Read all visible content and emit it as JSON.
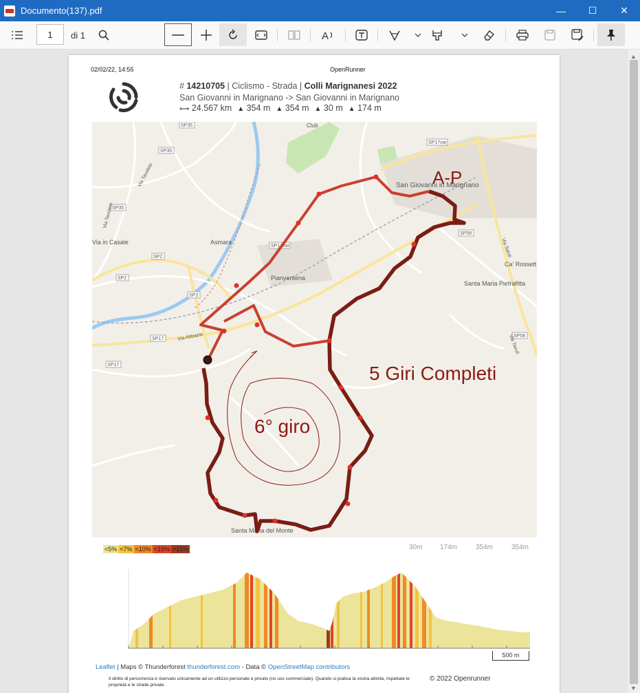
{
  "window": {
    "title": "Documento(137).pdf",
    "minimize": "—",
    "maximize": "☐",
    "close": "✕"
  },
  "toolbar": {
    "page_number": "1",
    "page_total": "di 1",
    "icons": [
      "contents-icon",
      "search-icon",
      "zoom-out-icon",
      "zoom-in-icon",
      "rotate-icon",
      "fit-width-icon",
      "two-page-icon",
      "read-aloud-icon",
      "text-icon",
      "draw-icon",
      "chevron-down-icon",
      "highlight-icon",
      "chevron-down-icon",
      "eraser-icon",
      "print-icon",
      "save-icon",
      "save-as-icon",
      "pin-icon"
    ]
  },
  "page": {
    "header_date": "02/02/22, 14:55",
    "header_site": "OpenRunner",
    "route": {
      "id_prefix": "#",
      "id": "14210705",
      "category": "| Ciclismo - Strada |",
      "name": "Colli Marignanesi 2022",
      "start_end": "San Giovanni in Marignano -> San Giovanni in Marignano",
      "distance": "24.567 km",
      "ascent": "354 m",
      "descent": "354 m",
      "min_alt": "30 m",
      "max_alt": "174 m"
    },
    "map": {
      "labels": {
        "club": "Club",
        "san_giovanni": "San Giovanni in Marignano",
        "pianventena": "Pianventena",
        "asmara": "Asmara",
        "ca_rossett": "Ca' Rossett",
        "santa_maria_pietrafitta": "Santa Maria Pietrafitta",
        "via_casale": "Via in Casale",
        "santa_maria_monte": "Santa Maria del Monte",
        "via_abbazia": "Via Abbazia",
        "via_tavoleto": "Via Tavoleto",
        "via_tavoleto2": "Via Tavoleto",
        "sp35": "SP35",
        "sp35b": "SP35",
        "sp35c": "SP35",
        "sp17var": "SP17var",
        "sp17var2": "SP17var",
        "sp58": "SP58",
        "sp58b": "SP58",
        "sp2": "SP2",
        "sp2b": "SP2",
        "sp2c": "SP2",
        "sp17": "SP17",
        "sp17b": "SP17",
        "via_saluti": "Via Saluti",
        "via_tavull": "Via Tavull"
      },
      "annotations": {
        "start_marker": "A-P",
        "full_laps": "5 Giri Completi",
        "sixth_lap": "6° giro"
      }
    },
    "profile": {
      "legend": [
        "<5%",
        "<7%",
        "<10%",
        "<15%",
        ">15%"
      ],
      "legend_colors": [
        "#f0e68c",
        "#f5c242",
        "#f08a24",
        "#e0442a",
        "#9c3b22"
      ],
      "stats": [
        "30m",
        "174m",
        "354m",
        "354m"
      ],
      "scale": "500 m"
    },
    "attribution": {
      "leaflet": "Leaflet",
      "maps": "| Maps ©",
      "thunderforest": "Thunderforest",
      "thunderforest_link": "thunderforest.com",
      "data": "- Data ©",
      "osm": "OpenStreetMap contributors"
    },
    "legal": "Il diritto di percorrenza è riservato unicamente ad un utilizzo personale e privato (no uso commerciale). Quando si pratica la vostra attività, rispettate le proprietà e le strade private.",
    "copyright": "© 2022 Openrunner"
  }
}
